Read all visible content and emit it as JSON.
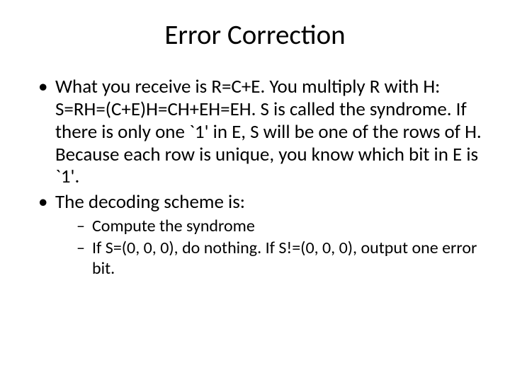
{
  "title": "Error Correction",
  "bullets": [
    {
      "text": "What you receive is R=C+E. You multiply R with H: S=RH=(C+E)H=CH+EH=EH. S is called the syndrome. If there is only one `1' in E, S will be one of the rows of H. Because each row is unique, you know which bit in E is `1'."
    },
    {
      "text": "The decoding scheme is:",
      "sub": [
        "Compute the syndrome",
        "If S=(0, 0, 0), do nothing. If S!=(0, 0, 0), output one error bit."
      ]
    }
  ]
}
